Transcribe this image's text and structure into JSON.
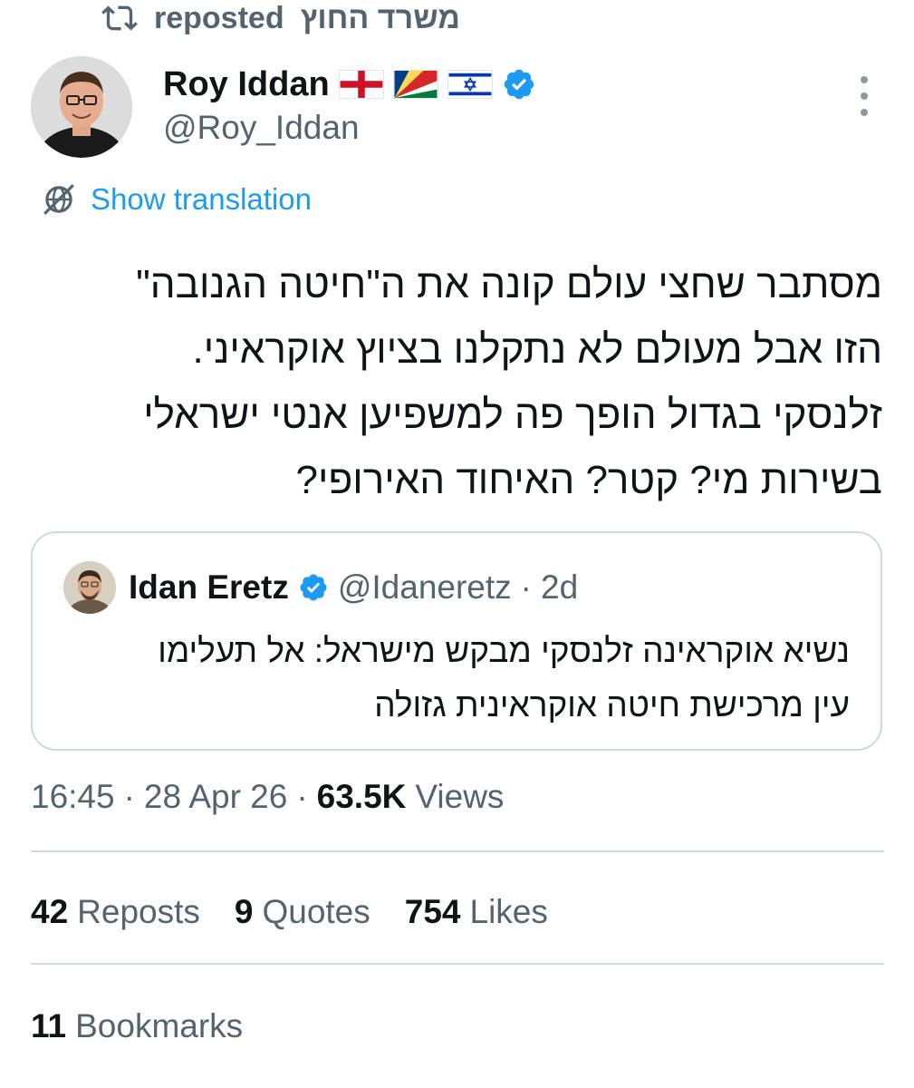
{
  "repost": {
    "label": "reposted",
    "account": "משרד החוץ",
    "icon": "repost-icon"
  },
  "author": {
    "name": "Roy Iddan",
    "handle": "@Roy_Iddan",
    "flags": [
      "england-flag",
      "seychelles-flag",
      "israel-flag"
    ],
    "verified": true,
    "verified_color": "#1d9bf0"
  },
  "translation": {
    "label": "Show translation",
    "icon": "translate-globe-icon",
    "color": "#1d9bf0"
  },
  "tweet": {
    "text": "מסתבר שחצי עולם קונה את ה\"חיטה הגנובה\"\nהזו אבל מעולם לא נתקלנו בציוץ אוקראיני.\nזלנסקי בגדול הופך פה למשפיען אנטי ישראלי\nבשירות מי? קטר? האיחוד האירופי?"
  },
  "quote": {
    "name": "Idan Eretz",
    "handle": "@Idaneretz",
    "separator": "·",
    "age": "2d",
    "verified": true,
    "text": "נשיא אוקראינה זלנסקי מבקש מישראל: אל תעלימו\nעין מרכישת חיטה אוקראינית גזולה"
  },
  "meta": {
    "time": "16:45",
    "separator": "·",
    "date": "28 Apr 26",
    "views_count": "63.5K",
    "views_label": "Views"
  },
  "stats": {
    "reposts_count": "42",
    "reposts_label": "Reposts",
    "quotes_count": "9",
    "quotes_label": "Quotes",
    "likes_count": "754",
    "likes_label": "Likes",
    "bookmarks_count": "11",
    "bookmarks_label": "Bookmarks"
  }
}
